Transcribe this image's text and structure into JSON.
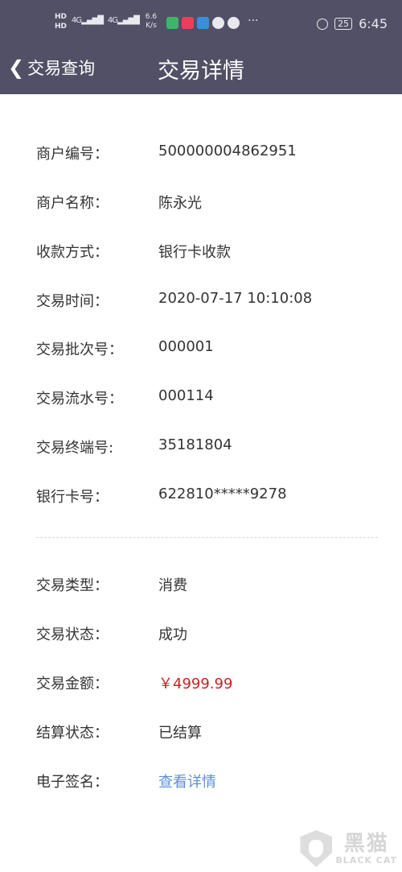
{
  "status_bar": {
    "hd1": "HD",
    "hd2": "HD",
    "net1": "4G",
    "net2": "4G",
    "speed_value": "6.6",
    "speed_unit": "K/s",
    "more": "···",
    "battery": "25",
    "time": "6:45"
  },
  "nav": {
    "back_label": "交易查询",
    "title": "交易详情"
  },
  "details": [
    {
      "label": "商户编号：",
      "value": "500000004862951"
    },
    {
      "label": "商户名称：",
      "value": "陈永光"
    },
    {
      "label": "收款方式：",
      "value": "银行卡收款"
    },
    {
      "label": "交易时间：",
      "value": "2020-07-17 10:10:08"
    },
    {
      "label": "交易批次号：",
      "value": "000001"
    },
    {
      "label": "交易流水号：",
      "value": "000114"
    },
    {
      "label": "交易终端号:",
      "value": "35181804"
    },
    {
      "label": "银行卡号：",
      "value": "622810*****9278"
    }
  ],
  "summary": [
    {
      "label": "交易类型：",
      "value": "消费"
    },
    {
      "label": "交易状态：",
      "value": "成功"
    },
    {
      "label": "交易金额：",
      "value": "￥4999.99"
    },
    {
      "label": "结算状态：",
      "value": "已结算"
    },
    {
      "label": "电子签名：",
      "value": "查看详情"
    }
  ],
  "colors": {
    "header_bg": "#525066",
    "amount": "#cc1f1f",
    "link": "#5b8fd6"
  },
  "watermark": {
    "cn": "黑猫",
    "en": "BLACK CAT"
  }
}
